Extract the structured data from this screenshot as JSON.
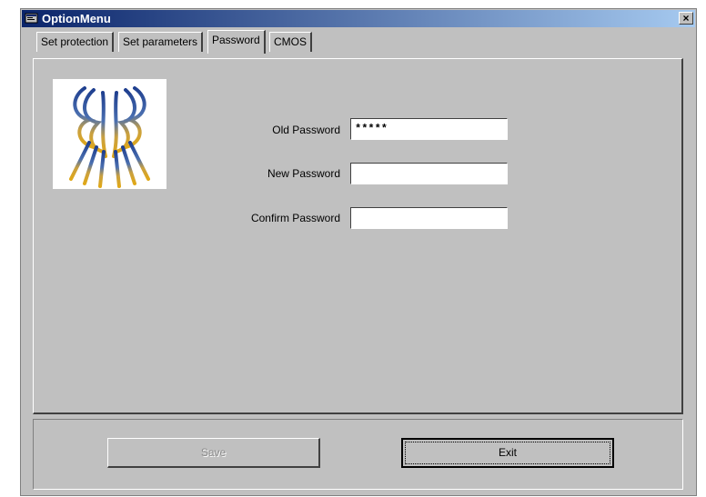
{
  "window": {
    "title": "OptionMenu",
    "close_label": "×"
  },
  "tabs": [
    {
      "label": "Set protection"
    },
    {
      "label": "Set parameters"
    },
    {
      "label": "Password",
      "active": true
    },
    {
      "label": "CMOS"
    }
  ],
  "form": {
    "old_password": {
      "label": "Old Password",
      "value": "*****"
    },
    "new_password": {
      "label": "New Password",
      "value": ""
    },
    "confirm_password": {
      "label": "Confirm Password",
      "value": ""
    }
  },
  "buttons": {
    "save_label": "Save",
    "exit_label": "Exit"
  },
  "icons": {
    "title_icon": "app-window-icon",
    "logo": "wings-logo-icon"
  },
  "colors": {
    "titlebar_start": "#0a246a",
    "titlebar_end": "#a6caf0",
    "face": "#c0c0c0"
  }
}
